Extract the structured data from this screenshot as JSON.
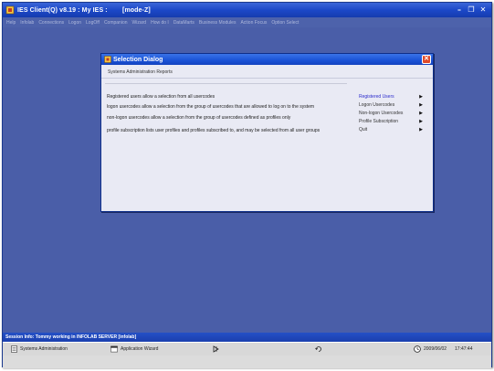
{
  "window": {
    "title": "IES Client(Q) v8.19 : My IES :        [mode-Z]",
    "minimize": "–",
    "restore": "❐",
    "close": "✕"
  },
  "menu": [
    "Help",
    "Infolab",
    "Connections",
    "Logon",
    "LogOff",
    "Companion",
    "Wizard",
    "How do I",
    "DataMarts",
    "Business Modules",
    "Action Focus",
    "Option Select"
  ],
  "dialog": {
    "title": "Selection Dialog",
    "close": "✕",
    "header": "Systems Administration Reports",
    "descriptions": [
      "Registered users allow a selection from all usercodes",
      "logon usercodes allow a selection from the group of usercodes that are allowed to log on to the system",
      "non-logon usercodes allow a selection from the group of usercodes defined as profiles only",
      "profile subscription lists user profiles and profiles subscribed to, and may be selected from all user groups"
    ],
    "options": [
      {
        "label": "Registered Users",
        "arrow": "▶"
      },
      {
        "label": "Logon Usercodes",
        "arrow": "▶"
      },
      {
        "label": "Non-logon Usercodes",
        "arrow": "▶"
      },
      {
        "label": "Profile Subscription",
        "arrow": "▶"
      },
      {
        "label": "Quit",
        "arrow": "▶"
      }
    ]
  },
  "status": {
    "session": "Session Info: Tommy working in INFOLAB SERVER  [infolab]"
  },
  "taskbar": {
    "systems_admin": "Systems Administration",
    "app_wizard": "Application Wizard",
    "date": "2009/06/02",
    "time": "17:47:44"
  },
  "colors": {
    "workspace": "#4a5ea8",
    "title_bar": "#1c48c8",
    "active_option": "#2b2bcc",
    "dialog_close": "#e04a2a"
  }
}
